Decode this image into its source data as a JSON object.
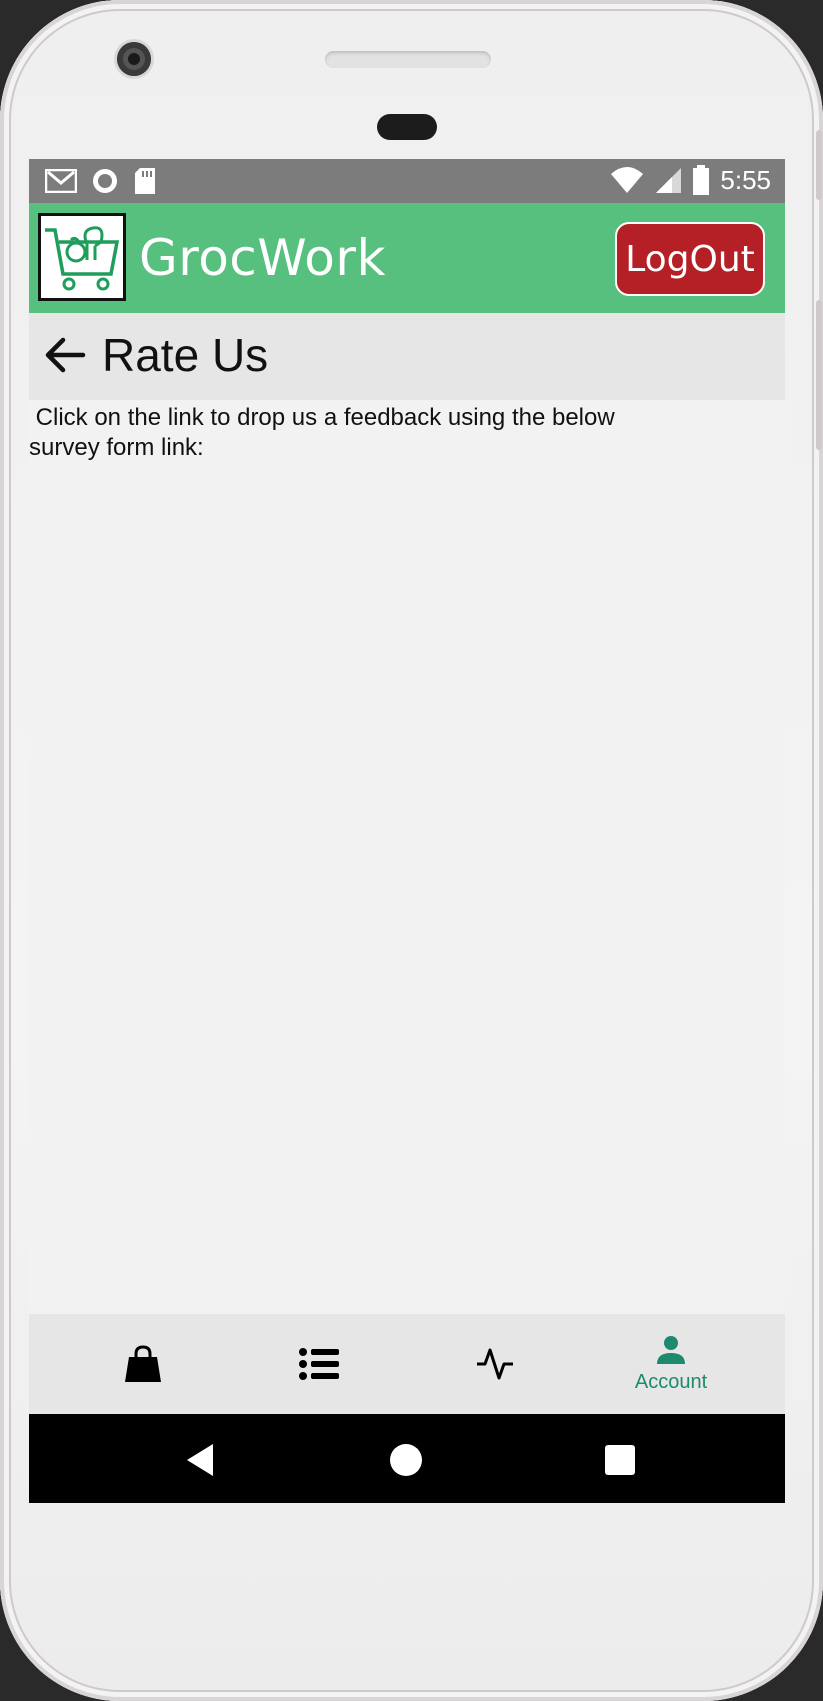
{
  "status_bar": {
    "time": "5:55",
    "left_icons": [
      "gmail-icon",
      "record-icon",
      "sd-card-icon"
    ],
    "right_icons": [
      "wifi-icon",
      "signal-icon",
      "battery-icon"
    ]
  },
  "app_bar": {
    "brand": "GrocWork",
    "logout_label": "LogOut",
    "colors": {
      "bar": "#58c07e",
      "logout": "#b52026"
    }
  },
  "page": {
    "title": "Rate Us",
    "message": " Click on the link to drop us a feedback using the below\nsurvey form link:"
  },
  "bottom_nav": {
    "items": [
      {
        "icon": "shopping-bag-icon",
        "label": ""
      },
      {
        "icon": "list-icon",
        "label": ""
      },
      {
        "icon": "activity-icon",
        "label": ""
      },
      {
        "icon": "account-icon",
        "label": "Account",
        "active": true
      }
    ],
    "active_color": "#1d8a6e"
  },
  "system_nav": [
    "back-triangle-icon",
    "home-circle-icon",
    "recents-square-icon"
  ]
}
